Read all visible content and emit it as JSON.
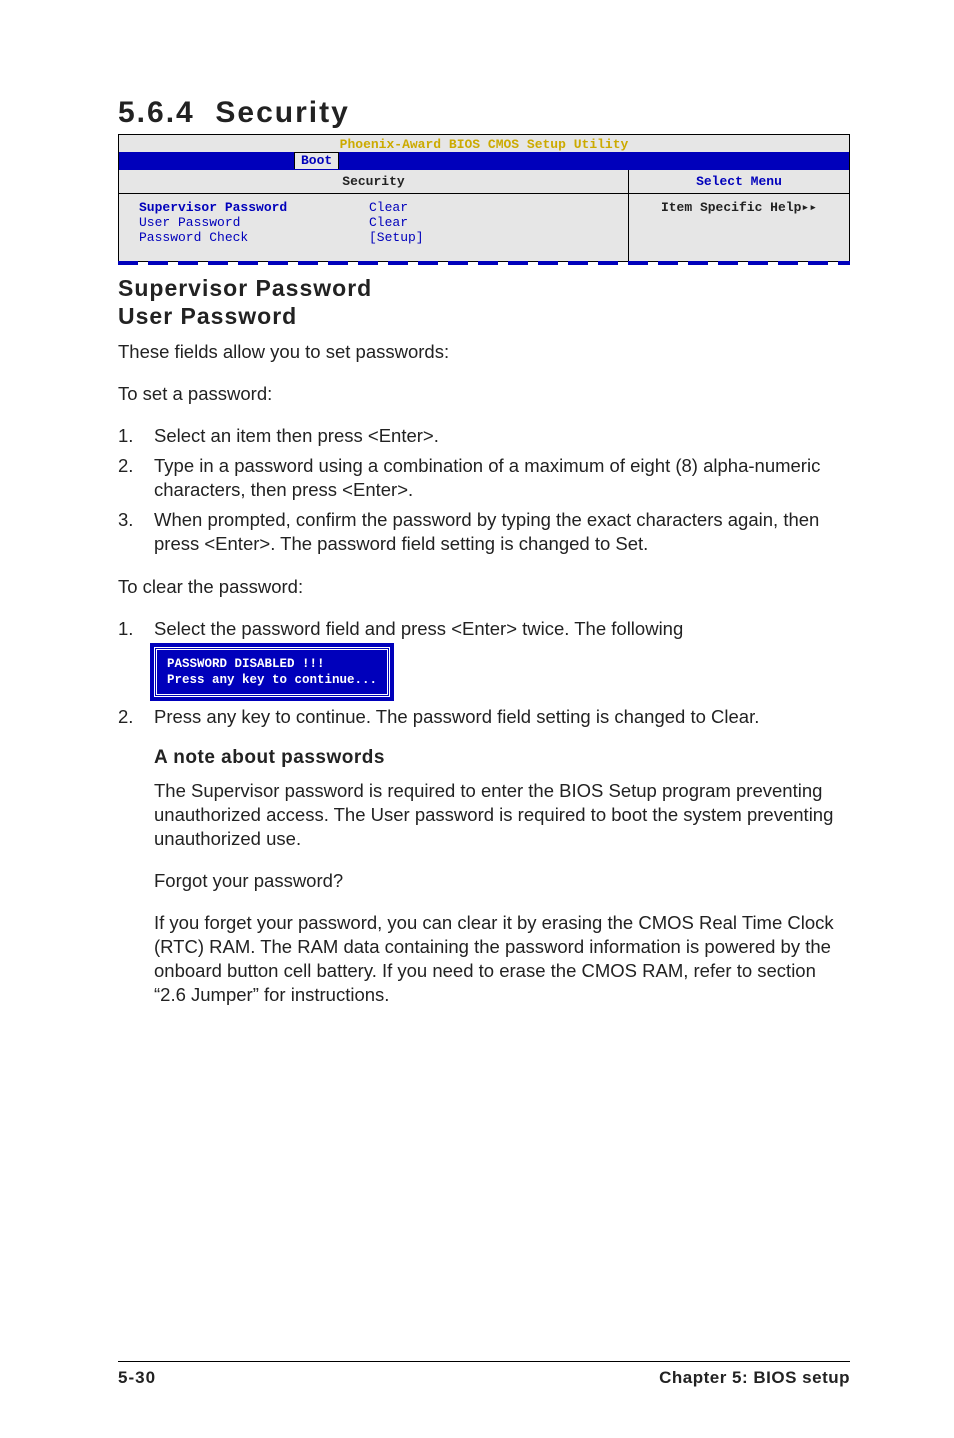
{
  "section": {
    "number": "5.6.4",
    "title": "Security"
  },
  "bios": {
    "utility_title": "Phoenix-Award BIOS CMOS Setup Utility",
    "tab": "Boot",
    "left_header": "Security",
    "right_header": "Select Menu",
    "settings": [
      {
        "label": "Supervisor Password",
        "value": "Clear",
        "bold": true
      },
      {
        "label": "User Password",
        "value": "Clear",
        "bold": false
      },
      {
        "label": "Password Check",
        "value": "[Setup]",
        "bold": false
      }
    ],
    "help_text": "Item Specific Help▸▸"
  },
  "headings": {
    "supervisor": "Supervisor Password",
    "user": "User Password"
  },
  "intro": "These fields allow you to set passwords:",
  "set_intro": "To set a password:",
  "set_steps": [
    "Select an item then press <Enter>.",
    "Type in a password using a combination of a maximum of eight (8) alpha-numeric characters, then press <Enter>.",
    "When prompted, confirm the password by typing the exact characters again, then press <Enter>. The password field setting is changed to Set."
  ],
  "clear_intro": "To clear the password:",
  "clear_steps_1": "Select the password field and press <Enter> twice. The following",
  "msg_box": "PASSWORD DISABLED !!!\nPress any key to continue...",
  "clear_steps_2": "Press any key to continue. The password field setting is changed to Clear.",
  "note": {
    "heading": "A note about passwords",
    "p1": "The Supervisor password is required to enter the BIOS Setup program preventing unauthorized access. The User password is required to boot the system preventing unauthorized use.",
    "p2": "Forgot your password?",
    "p3": "If you forget your password, you can clear it by erasing the CMOS Real Time Clock (RTC) RAM. The RAM data containing the password information is powered by the onboard button cell battery. If you need to erase the CMOS RAM, refer to section “2.6 Jumper” for instructions."
  },
  "footer": {
    "page": "5-30",
    "chapter": "Chapter 5: BIOS setup"
  }
}
